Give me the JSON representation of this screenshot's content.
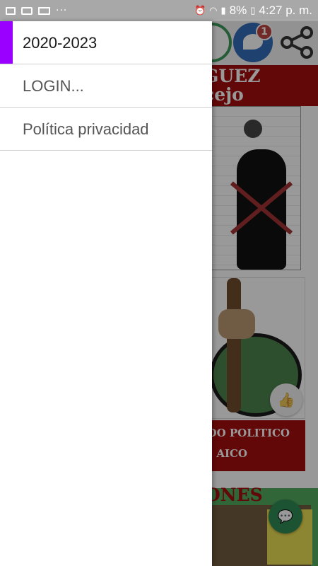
{
  "status_bar": {
    "battery": "8%",
    "time": "4:27 p. m.",
    "dots": "···",
    "icons": [
      "image-icon",
      "video-icon",
      "laptop-icon",
      "alarm-icon",
      "wifi-icon",
      "signal-icon",
      "battery-icon"
    ]
  },
  "drawer": {
    "accent_color": "#9a00ff",
    "items": [
      {
        "label": "2020-2023",
        "active": true
      },
      {
        "label": "LOGIN...",
        "active": false
      },
      {
        "label": "Política privacidad",
        "active": false
      }
    ]
  },
  "background_app": {
    "messenger_badge": "1",
    "banner_text_line1": "GUEZ",
    "banner_text_line2": "cejo",
    "red_box_line1": "DO POLITICO",
    "red_box_line2": "AICO",
    "section_label": "ONES",
    "icons": [
      "whatsapp-icon",
      "messenger-icon",
      "share-icon",
      "clock-icon",
      "forward-icon",
      "thumbs-up-icon",
      "chat-icon"
    ]
  }
}
